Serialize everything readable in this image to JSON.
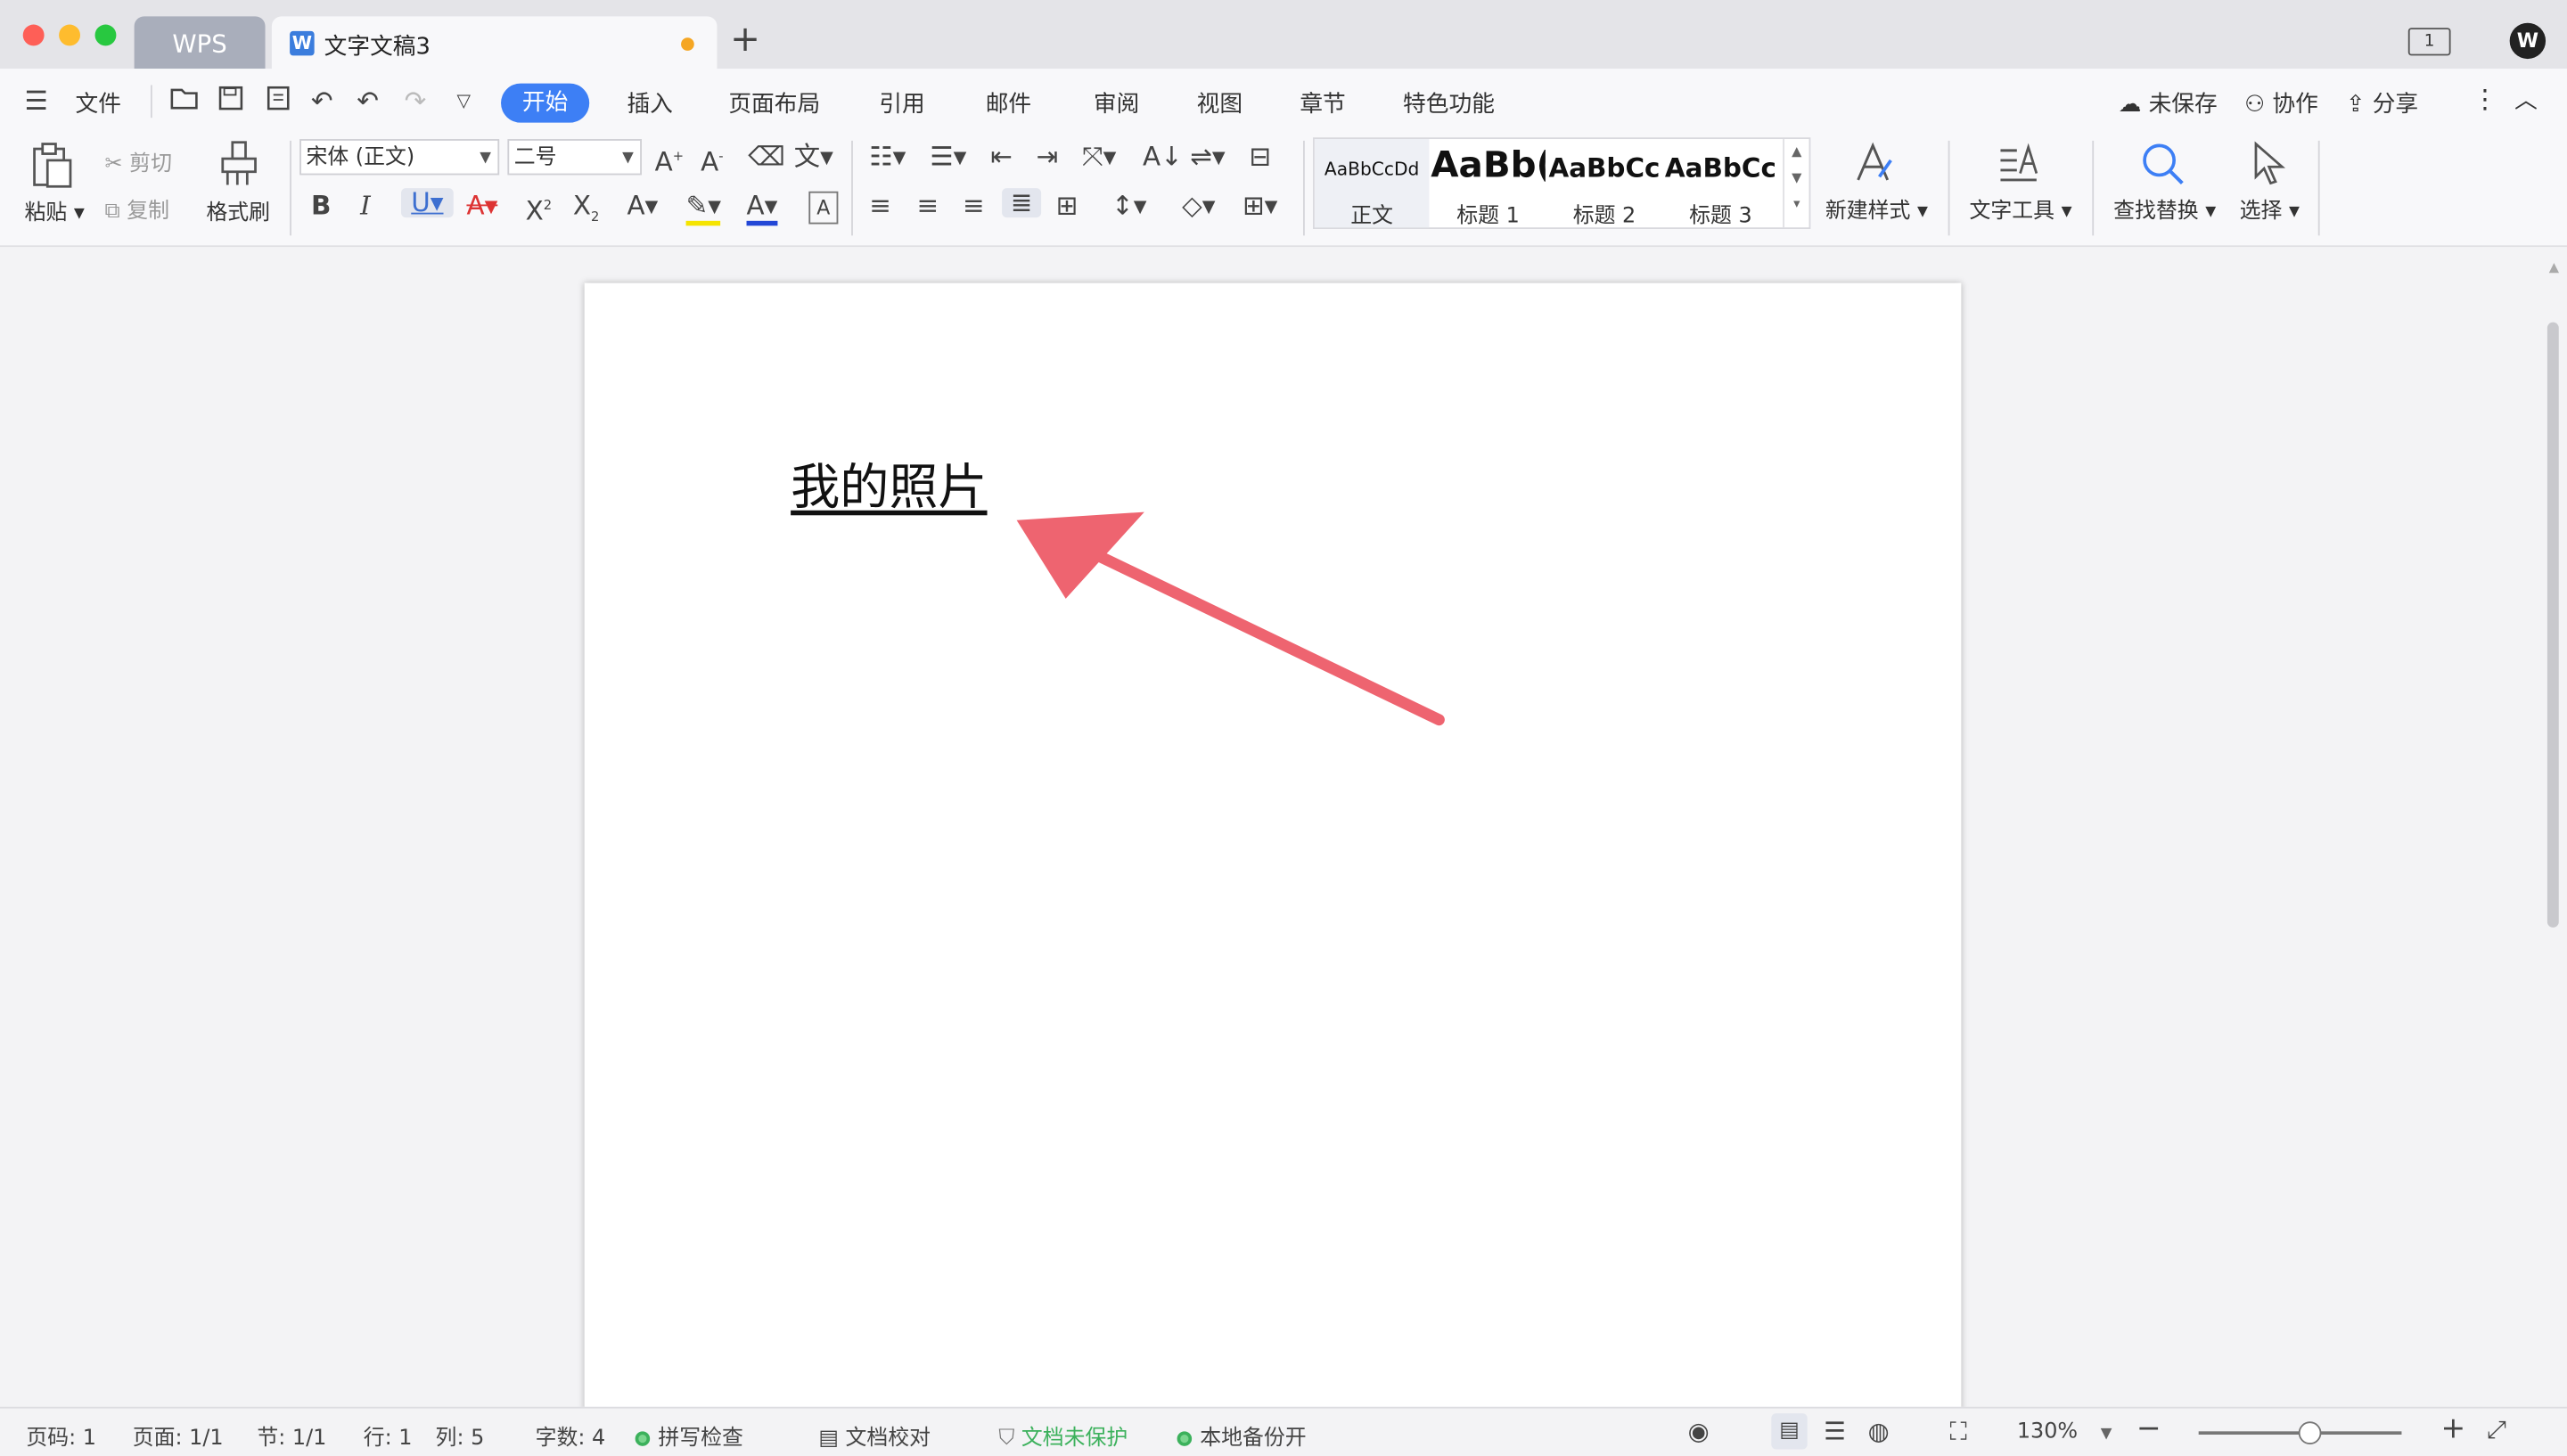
{
  "titlebar": {
    "tabs": [
      {
        "label": "WPS"
      },
      {
        "label": "文字文稿3",
        "icon": "wps-writer-icon",
        "modified": true
      }
    ]
  },
  "menubar": {
    "file_label": "文件",
    "tabs": [
      "开始",
      "插入",
      "页面布局",
      "引用",
      "邮件",
      "审阅",
      "视图",
      "章节",
      "特色功能"
    ],
    "active_tab": "开始",
    "right": {
      "unsaved": "未保存",
      "collaborate": "协作",
      "share": "分享"
    }
  },
  "ribbon": {
    "paste": "粘贴",
    "cut": "剪切",
    "copy": "复制",
    "format_painter": "格式刷",
    "font_name": "宋体 (正文)",
    "font_size": "二号",
    "styles": [
      {
        "preview": "AaBbCcDd",
        "name": "正文"
      },
      {
        "preview": "AaBb(",
        "name": "标题 1"
      },
      {
        "preview": "AaBbCc",
        "name": "标题 2"
      },
      {
        "preview": "AaBbCc",
        "name": "标题 3"
      }
    ],
    "new_style": "新建样式",
    "text_tools": "文字工具",
    "find_replace": "查找替换",
    "select": "选择"
  },
  "document": {
    "text": "我的照片",
    "annotation_color": "#ee6470"
  },
  "statusbar": {
    "page_num": "页码: 1",
    "pages": "页面: 1/1",
    "section": "节: 1/1",
    "row": "行: 1",
    "col": "列: 5",
    "word_count": "字数: 4",
    "spell_check": "拼写检查",
    "proofread": "文档校对",
    "protection": "文档未保护",
    "backup": "本地备份开",
    "zoom": "130%"
  },
  "colors": {
    "accent": "#3d7ff5",
    "protect_green": "#3cb15c"
  }
}
